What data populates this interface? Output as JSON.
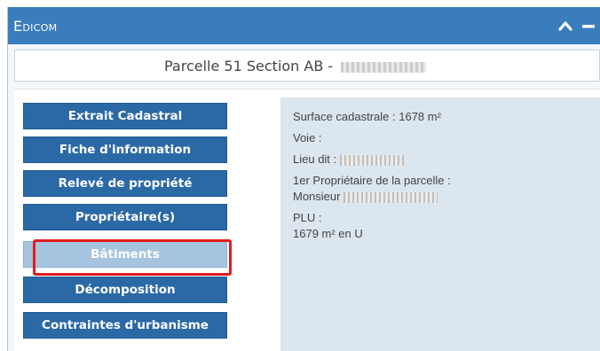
{
  "window": {
    "title": "Edicom",
    "controls": [
      "chevron-up-icon",
      "minimize-icon"
    ]
  },
  "header": {
    "text": "Parcelle 51 Section AB - "
  },
  "nav": {
    "items": [
      {
        "label": "Extrait Cadastral"
      },
      {
        "label": "Fiche d'information"
      },
      {
        "label": "Relevé de propriété"
      },
      {
        "label": "Propriétaire(s)"
      },
      {
        "label": "Bâtiments",
        "active": true
      },
      {
        "label": "Décomposition"
      },
      {
        "label": "Contraintes d'urbanisme"
      }
    ]
  },
  "info": {
    "surface": "Surface cadastrale : 1678 m²",
    "voie": "Voie :",
    "lieu_dit": "Lieu dit :",
    "owner_label": "1er Propriétaire de la parcelle :",
    "owner_prefix": "Monsieur",
    "plu_label": "PLU :",
    "plu_value": "1679 m² en U"
  },
  "colors": {
    "titlebar": "#3a7dbd",
    "nav_button": "#2b69a6",
    "nav_active": "#a7c4de",
    "highlight": "#e21b1b",
    "info_panel": "#dce6ef"
  }
}
